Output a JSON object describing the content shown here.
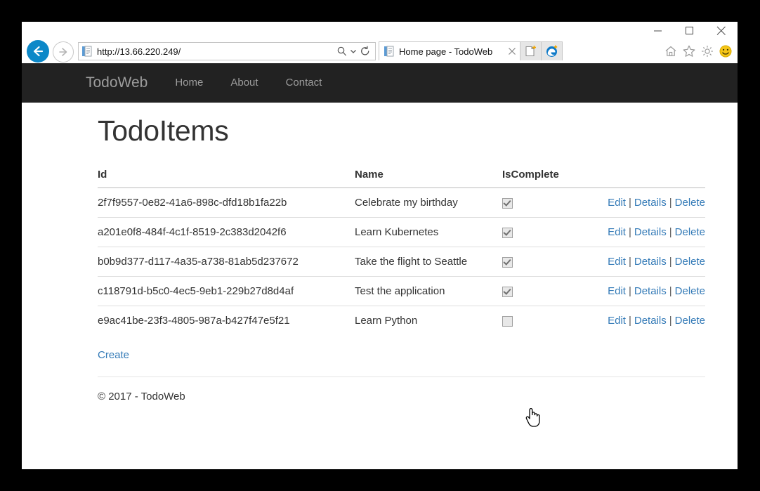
{
  "window": {
    "minimize_icon": "minimize-icon",
    "maximize_icon": "maximize-icon",
    "close_icon": "close-icon"
  },
  "browser": {
    "back_icon": "back-arrow-icon",
    "forward_icon": "forward-arrow-icon",
    "address_value": "http://13.66.220.249/",
    "address_placeholder": "",
    "page_icon": "page-document-icon",
    "search_icon": "search-icon",
    "search_caret_icon": "chevron-down-icon",
    "refresh_icon": "refresh-icon",
    "tab_title": "Home page - TodoWeb",
    "tab_favicon": "page-document-icon",
    "tab_close_icon": "close-icon",
    "new_tab_icon": "new-tab-icon",
    "edge_icon": "edge-browser-icon",
    "commands": [
      {
        "name": "home-icon",
        "label": "Home"
      },
      {
        "name": "favorites-star-icon",
        "label": "Favorites"
      },
      {
        "name": "gear-icon",
        "label": "Tools"
      },
      {
        "name": "smiley-feedback-icon",
        "label": "Send feedback"
      }
    ]
  },
  "site": {
    "brand": "TodoWeb",
    "nav": [
      {
        "label": "Home"
      },
      {
        "label": "About"
      },
      {
        "label": "Contact"
      }
    ]
  },
  "page": {
    "title": "TodoItems",
    "create_label": "Create",
    "footer": "© 2017 - TodoWeb"
  },
  "table": {
    "columns": [
      "Id",
      "Name",
      "IsComplete",
      ""
    ],
    "actions": {
      "edit": "Edit",
      "details": "Details",
      "delete": "Delete",
      "separator": "|"
    },
    "rows": [
      {
        "id": "2f7f9557-0e82-41a6-898c-dfd18b1fa22b",
        "name": "Celebrate my birthday",
        "is_complete": true
      },
      {
        "id": "a201e0f8-484f-4c1f-8519-2c383d2042f6",
        "name": "Learn Kubernetes",
        "is_complete": true
      },
      {
        "id": "b0b9d377-d117-4a35-a738-81ab5d237672",
        "name": "Take the flight to Seattle",
        "is_complete": true
      },
      {
        "id": "c118791d-b5c0-4ec5-9eb1-229b27d8d4af",
        "name": "Test the application",
        "is_complete": true
      },
      {
        "id": "e9ac41be-23f3-4805-987a-b427f47e5f21",
        "name": "Learn Python",
        "is_complete": false
      }
    ]
  },
  "cursor": {
    "type": "pointer-hand-cursor"
  },
  "colors": {
    "navbar_bg": "#222222",
    "navbar_text": "#9d9d9d",
    "link": "#337ab7",
    "back_button": "#0c88c8",
    "page_bg": "#ffffff",
    "desktop_bg": "#000000"
  }
}
